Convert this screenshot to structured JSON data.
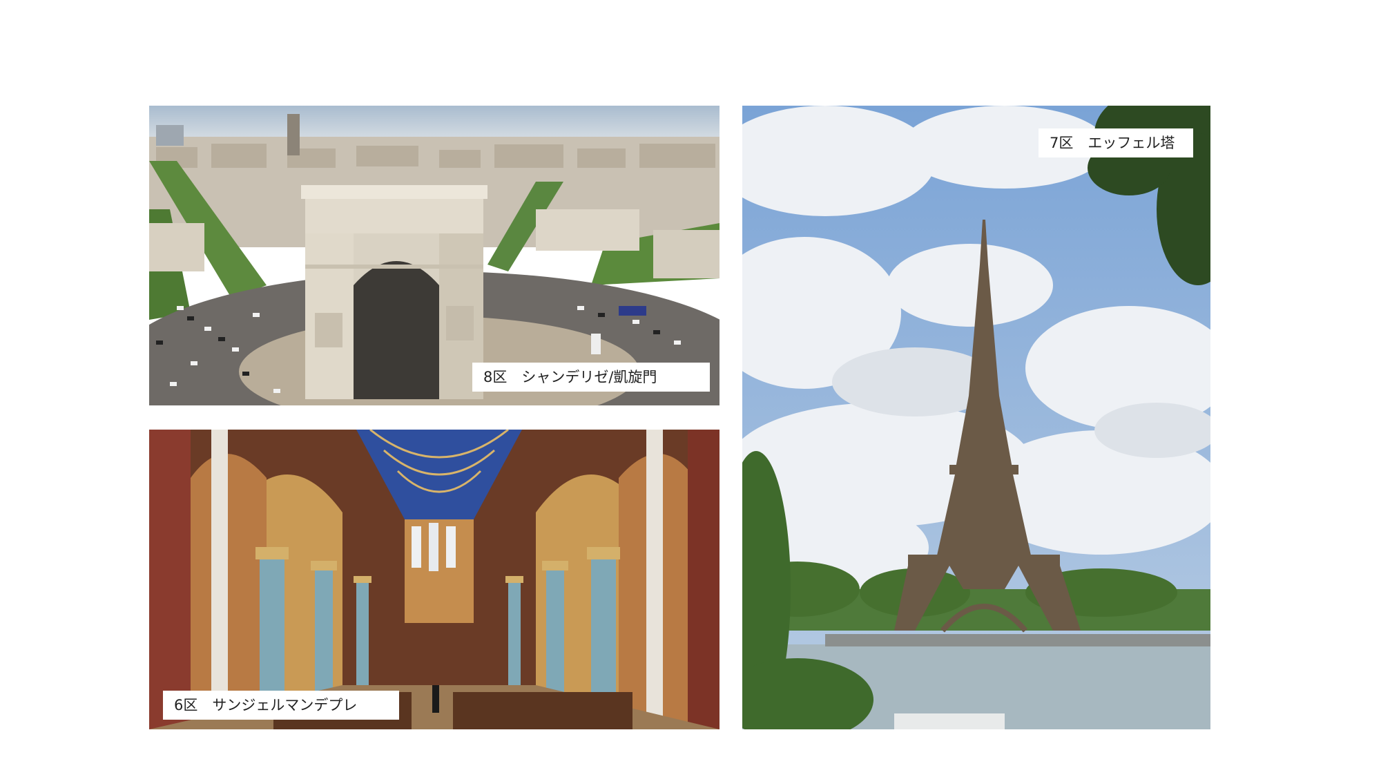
{
  "photos": {
    "arc": {
      "caption": "8区　シャンデリゼ/凱旋門",
      "subject": "Arc de Triomphe aerial view"
    },
    "church": {
      "caption": "6区　サンジェルマンデプレ",
      "subject": "Saint-Germain-des-Prés church interior"
    },
    "eiffel": {
      "caption": "7区　エッフェル塔",
      "subject": "Eiffel Tower over the Seine"
    }
  },
  "colors": {
    "sky_blue": "#7aa3d6",
    "cloud_white": "#eef1f5",
    "stone": "#d9d2c3",
    "tree_green": "#4f7a3a",
    "vault_blue": "#2f4f9e",
    "column_teal": "#7fa8b6",
    "wall_red": "#8a3b2e",
    "tower_brown": "#6b5a47",
    "river": "#a7b8c0"
  }
}
